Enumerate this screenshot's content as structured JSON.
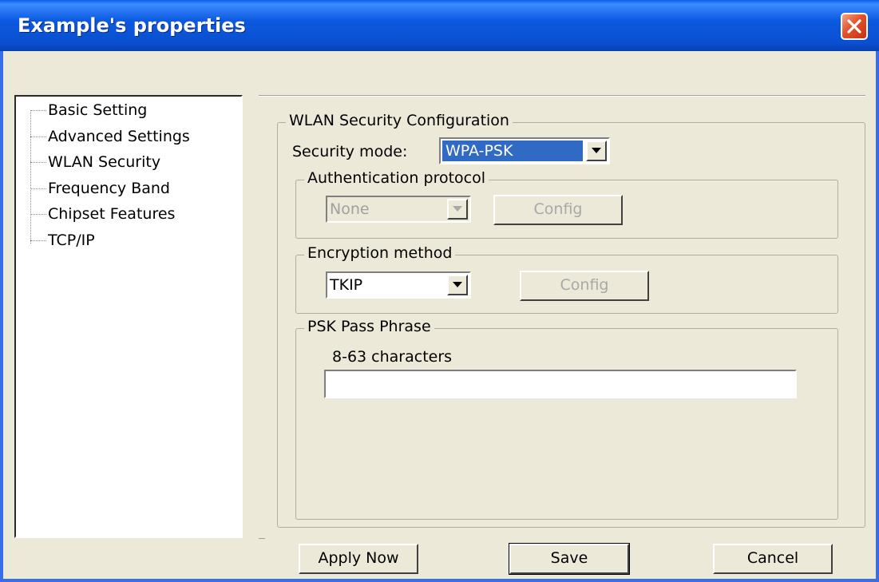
{
  "window": {
    "title": "Example's properties"
  },
  "tree": {
    "items": [
      {
        "label": "Basic Setting"
      },
      {
        "label": "Advanced Settings"
      },
      {
        "label": "WLAN Security"
      },
      {
        "label": "Frequency Band"
      },
      {
        "label": "Chipset Features"
      },
      {
        "label": "TCP/IP"
      }
    ]
  },
  "security": {
    "group_title": "WLAN Security Configuration",
    "mode_label": "Security mode:",
    "mode_value": "WPA-PSK",
    "auth": {
      "group_title": "Authentication protocol",
      "value": "None",
      "config_label": "Config"
    },
    "encryption": {
      "group_title": "Encryption method",
      "value": "TKIP",
      "config_label": "Config"
    },
    "psk": {
      "group_title": "PSK Pass Phrase",
      "hint": "8-63 characters",
      "value": ""
    }
  },
  "buttons": {
    "apply": "Apply Now",
    "save": "Save",
    "cancel": "Cancel"
  },
  "colors": {
    "titlebar": "#0a4fd0",
    "selection": "#316ac5",
    "dialog_bg": "#ece9d8",
    "close": "#e2512b"
  }
}
